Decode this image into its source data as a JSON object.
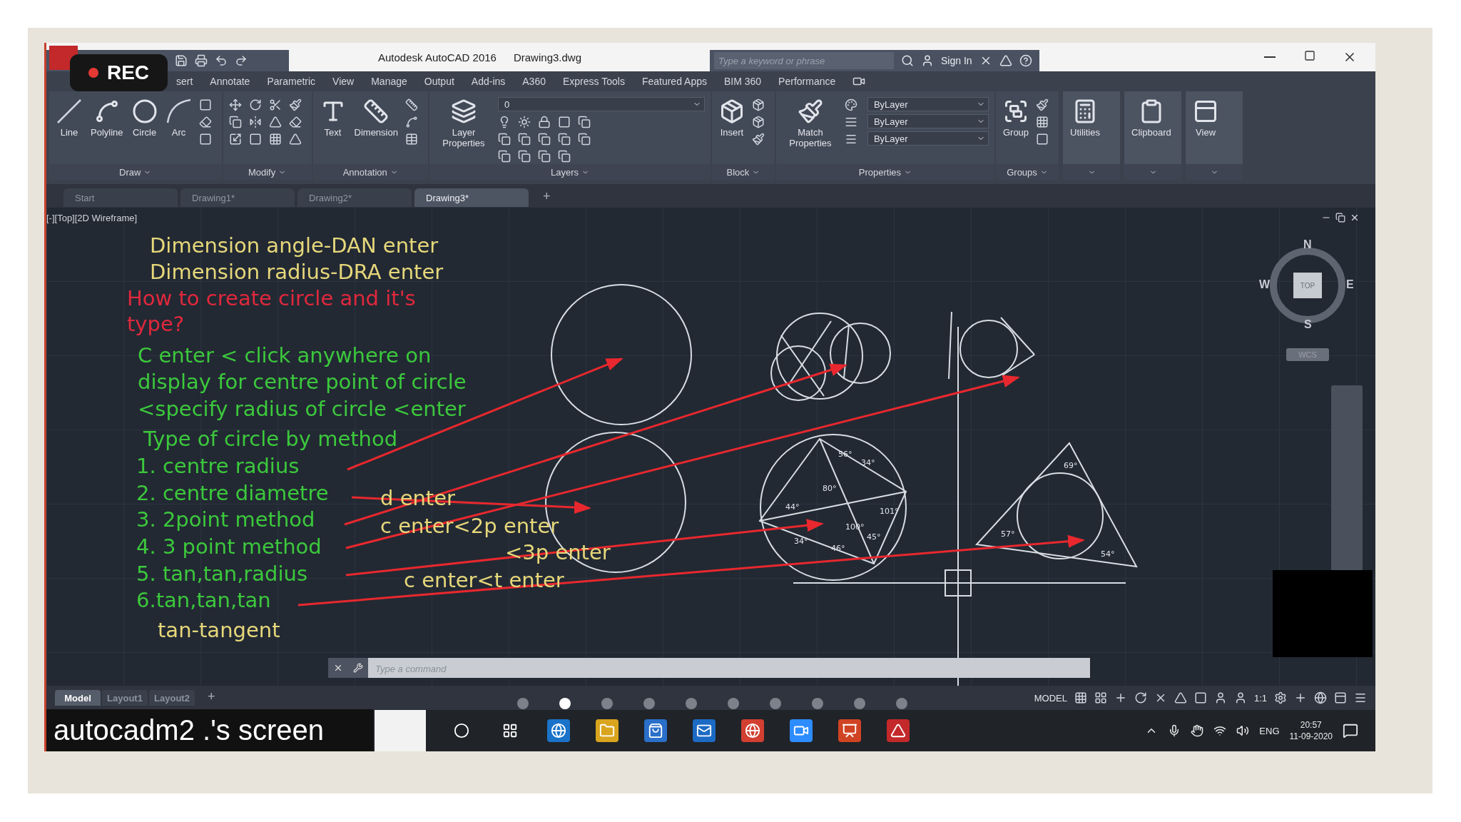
{
  "recording_badge": {
    "label": "REC"
  },
  "window": {
    "title": "Autodesk AutoCAD 2016",
    "file": "Drawing3.dwg"
  },
  "search": {
    "placeholder": "Type a keyword or phrase"
  },
  "account": {
    "label": "Sign In"
  },
  "menu_tabs": [
    "sert",
    "Annotate",
    "Parametric",
    "View",
    "Manage",
    "Output",
    "Add-ins",
    "A360",
    "Express Tools",
    "Featured Apps",
    "BIM 360",
    "Performance"
  ],
  "ribbon": [
    {
      "kind": "draw",
      "title": "Draw",
      "tools": [
        "Line",
        "Polyline",
        "Circle",
        "Arc"
      ]
    },
    {
      "kind": "modify",
      "title": "Modify"
    },
    {
      "kind": "annotation",
      "title": "Annotation",
      "tools": [
        "Text",
        "Dimension"
      ]
    },
    {
      "kind": "layers",
      "title": "Layers",
      "tools": [
        "Layer Properties"
      ],
      "dropdowns": [
        "0"
      ]
    },
    {
      "kind": "block",
      "title": "Block",
      "tools": [
        "Insert"
      ]
    },
    {
      "kind": "properties",
      "title": "Properties",
      "tools": [
        "Match Properties"
      ],
      "dropdowns": [
        "ByLayer",
        "ByLayer",
        "ByLayer"
      ]
    },
    {
      "kind": "groups",
      "title": "Groups",
      "tools": [
        "Group"
      ]
    },
    {
      "kind": "utilities",
      "tools": [
        "Utilities"
      ]
    },
    {
      "kind": "clipboard",
      "tools": [
        "Clipboard"
      ]
    },
    {
      "kind": "view",
      "tools": [
        "View"
      ]
    }
  ],
  "doc_tabs": [
    {
      "label": "Start",
      "selected": false
    },
    {
      "label": "Drawing1*",
      "selected": false
    },
    {
      "label": "Drawing2*",
      "selected": false
    },
    {
      "label": "Drawing3*",
      "selected": true
    }
  ],
  "new_tab": "+",
  "viewport": {
    "label": "[-][Top][2D Wireframe]",
    "notes": [
      {
        "text": "Dimension angle-DAN enter",
        "color": "#e6d77a"
      },
      {
        "text": "Dimension radius-DRA enter",
        "color": "#e6d77a"
      },
      {
        "text": "How to create circle and it's type?",
        "color": "#e0283c"
      },
      {
        "text": "C enter < click anywhere on",
        "color": "#3cc83c"
      },
      {
        "text": "display for centre point of circle",
        "color": "#3cc83c"
      },
      {
        "text": "<specify radius of circle <enter",
        "color": "#3cc83c"
      },
      {
        "text": "Type of circle by method",
        "color": "#3cc83c"
      },
      {
        "text": "1. centre radius",
        "color": "#3cc83c"
      },
      {
        "text": "2. centre diametre",
        "color": "#3cc83c"
      },
      {
        "text": "3. 2point method",
        "color": "#3cc83c"
      },
      {
        "text": "4. 3 point method",
        "color": "#3cc83c"
      },
      {
        "text": "5. tan,tan,radius",
        "color": "#3cc83c"
      },
      {
        "text": "6.tan,tan,tan",
        "color": "#3cc83c"
      },
      {
        "text": "tan-tangent",
        "color": "#e6d77a"
      },
      {
        "text": "d enter",
        "color": "#e6d77a"
      },
      {
        "text": "c enter<2p enter",
        "color": "#e6d77a"
      },
      {
        "text": "<3p enter",
        "color": "#e6d77a"
      },
      {
        "text": "c enter<t enter",
        "color": "#e6d77a"
      }
    ],
    "angles": [
      "56°",
      "34°",
      "80°",
      "101°",
      "44°",
      "34°",
      "100°",
      "46°",
      "45°",
      "69°",
      "57°",
      "54°"
    ],
    "compass": {
      "north": "N",
      "south": "S",
      "east": "E",
      "west": "W",
      "face": "TOP",
      "ucs": "WCS"
    }
  },
  "command_line": {
    "placeholder": "Type a command"
  },
  "layout_tabs": [
    {
      "label": "Model",
      "selected": true
    },
    {
      "label": "Layout1",
      "selected": false
    },
    {
      "label": "Layout2",
      "selected": false
    }
  ],
  "layout_add": "+",
  "status_bar": {
    "space": "MODEL",
    "scale": "1:1"
  },
  "slide_dots": [
    {
      "selected": false
    },
    {
      "selected": true
    },
    {
      "selected": false
    },
    {
      "selected": false
    },
    {
      "selected": false
    },
    {
      "selected": false
    },
    {
      "selected": false
    },
    {
      "selected": false
    },
    {
      "selected": false
    },
    {
      "selected": false
    }
  ],
  "share_label": "autocadm2 .'s screen",
  "tray": {
    "language": "ENG",
    "time": "20:57",
    "date": "11-09-2020"
  }
}
